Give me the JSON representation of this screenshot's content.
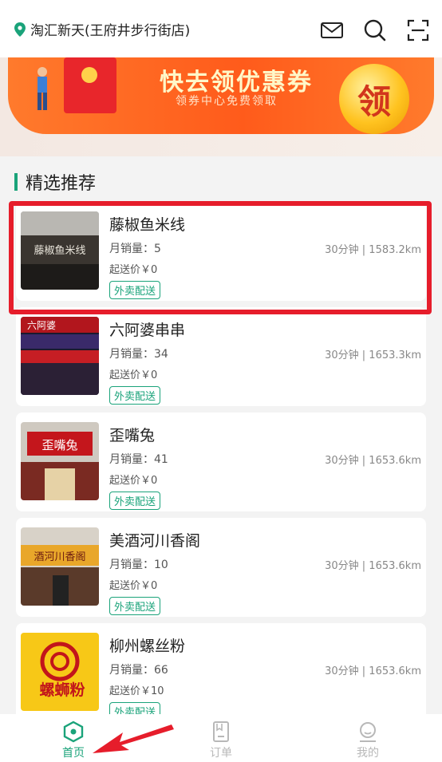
{
  "header": {
    "location": "淘汇新天(王府井步行街店)",
    "icons": [
      "location-pin-icon",
      "mail-icon",
      "search-icon",
      "scan-icon"
    ]
  },
  "banner": {
    "title": "快去领优惠券",
    "subtitle": "领券中心免费领取",
    "coin_label": "领"
  },
  "section": {
    "title": "精选推荐"
  },
  "stores": [
    {
      "name": "藤椒鱼米线",
      "sales": "月销量：5",
      "time_distance": "30分钟 | 1583.2km",
      "min_price": "起送价￥0",
      "tag": "外卖配送",
      "sign": "藤椒鱼米线"
    },
    {
      "name": "六阿婆串串",
      "sales": "月销量：34",
      "time_distance": "30分钟 | 1653.3km",
      "min_price": "起送价￥0",
      "tag": "外卖配送",
      "sign": "六阿婆"
    },
    {
      "name": "歪嘴兔",
      "sales": "月销量：41",
      "time_distance": "30分钟 | 1653.6km",
      "min_price": "起送价￥0",
      "tag": "外卖配送",
      "sign": "歪嘴兔"
    },
    {
      "name": "美酒河川香阁",
      "sales": "月销量：10",
      "time_distance": "30分钟 | 1653.6km",
      "min_price": "起送价￥0",
      "tag": "外卖配送",
      "sign": "酒河川香阁"
    },
    {
      "name": "柳州螺丝粉",
      "sales": "月销量：66",
      "time_distance": "30分钟 | 1653.6km",
      "min_price": "起送价￥10",
      "tag": "外卖配送",
      "sign": "螺蛳粉"
    }
  ],
  "tabs": [
    {
      "label": "首页",
      "active": true
    },
    {
      "label": "订单",
      "active": false
    },
    {
      "label": "我的",
      "active": false
    }
  ],
  "colors": {
    "accent": "#1aa37a",
    "highlight": "#e61d2b",
    "inactive": "#b8b8b8"
  }
}
